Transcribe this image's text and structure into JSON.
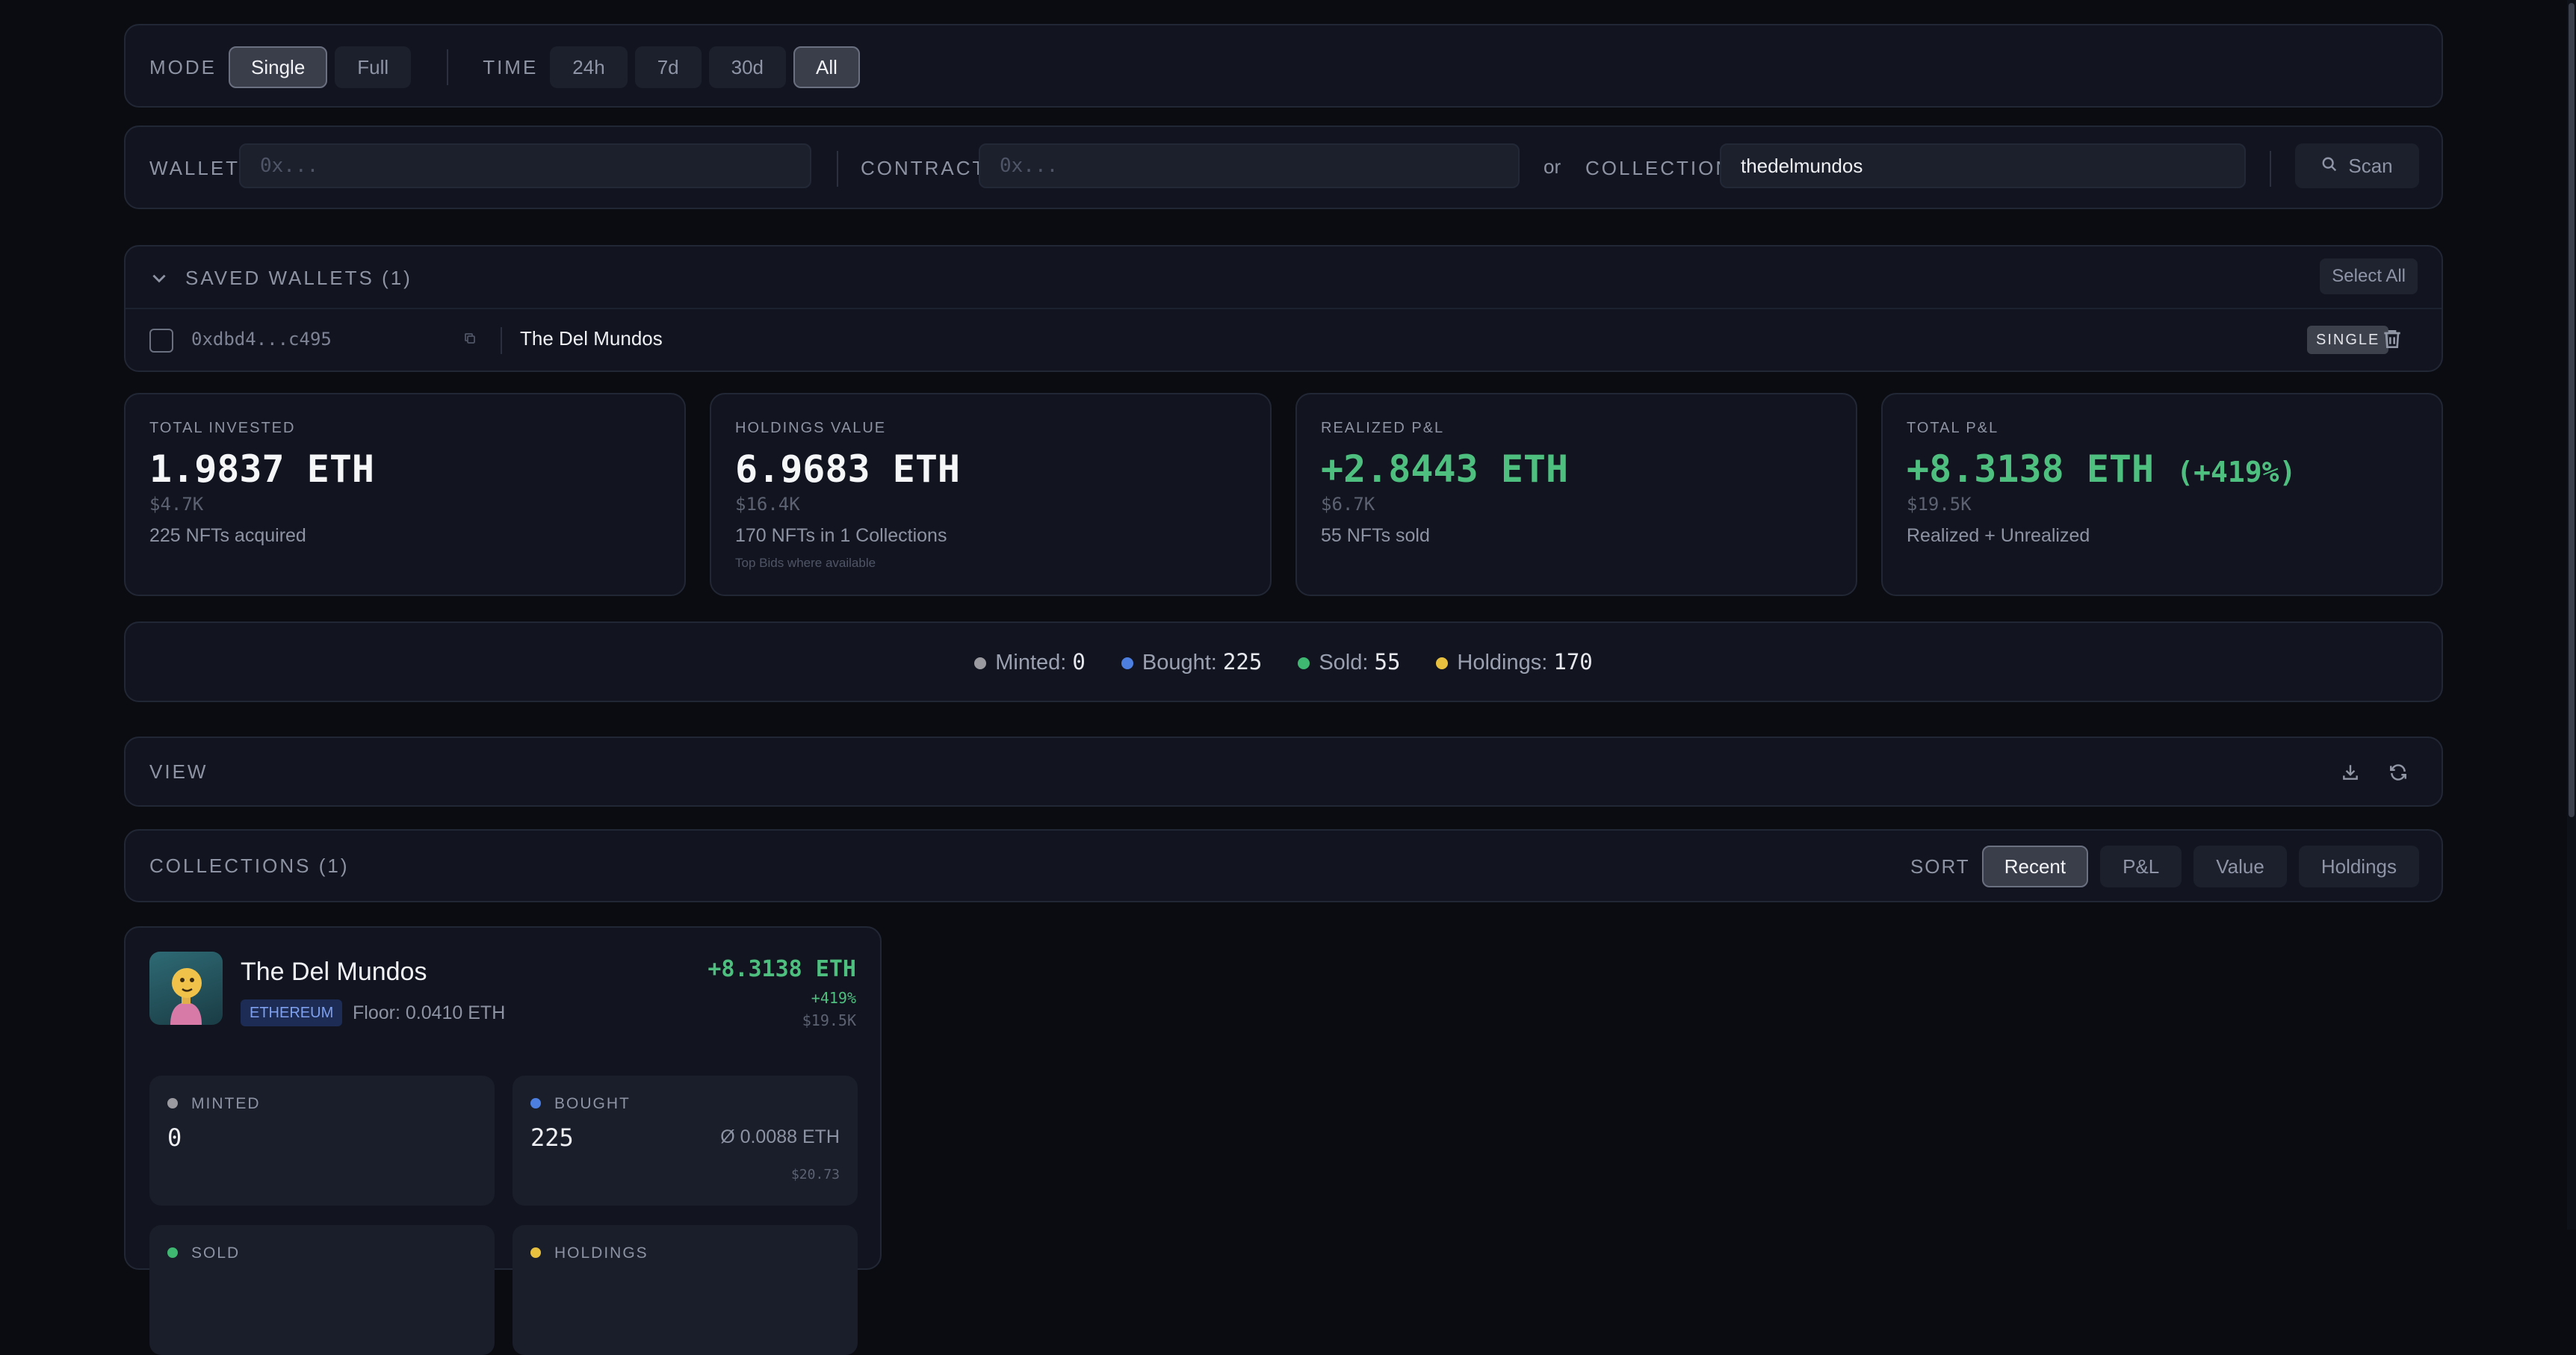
{
  "colors": {
    "background": "#0b0c12",
    "panel": "#121520",
    "accent_green": "#4fbf7f",
    "minted_dot": "#9a9aa0",
    "bought_dot": "#4c7fe0",
    "sold_dot": "#3fb872",
    "holdings_dot": "#e8c040",
    "chain_badge_bg": "#1d2c55",
    "chain_badge_text": "#7ea0ee"
  },
  "filters": {
    "mode_label": "MODE",
    "mode_options": [
      "Single",
      "Full"
    ],
    "mode_selected": "Single",
    "time_label": "TIME",
    "time_options": [
      "24h",
      "7d",
      "30d",
      "All"
    ],
    "time_selected": "All"
  },
  "search": {
    "wallet_label": "WALLET",
    "wallet_placeholder": "0x...",
    "contract_label": "CONTRACT",
    "contract_placeholder": "0x...",
    "or_text": "or",
    "collection_label": "COLLECTION",
    "collection_value": "thedelmundos",
    "scan_label": "Scan",
    "scan_icon": "search-icon"
  },
  "saved_wallets": {
    "title": "SAVED WALLETS (1)",
    "select_all": "Select All",
    "items": [
      {
        "address": "0xdbd4...c495",
        "name": "The Del Mundos",
        "mode_badge": "SINGLE"
      }
    ]
  },
  "stats": [
    {
      "label": "TOTAL INVESTED",
      "main": "1.9837 ETH",
      "pct": "",
      "usd": "$4.7K",
      "sub": "225 NFTs acquired",
      "tiny": ""
    },
    {
      "label": "HOLDINGS VALUE",
      "main": "6.9683 ETH",
      "pct": "",
      "usd": "$16.4K",
      "sub": "170 NFTs in 1 Collections",
      "tiny": "Top Bids where available"
    },
    {
      "label": "REALIZED P&L",
      "main": "+2.8443 ETH",
      "pct": "",
      "usd": "$6.7K",
      "sub": "55 NFTs sold",
      "tiny": ""
    },
    {
      "label": "TOTAL P&L",
      "main": "+8.3138 ETH",
      "pct": "(+419%)",
      "usd": "$19.5K",
      "sub": "Realized + Unrealized",
      "tiny": ""
    }
  ],
  "legend": [
    {
      "label": "Minted:",
      "value": "0"
    },
    {
      "label": "Bought:",
      "value": "225"
    },
    {
      "label": "Sold:",
      "value": "55"
    },
    {
      "label": "Holdings:",
      "value": "170"
    }
  ],
  "view": {
    "title": "VIEW"
  },
  "collections": {
    "title": "COLLECTIONS (1)",
    "sort_label": "SORT",
    "sort_options": [
      "Recent",
      "P&L",
      "Value",
      "Holdings"
    ],
    "sort_selected": "Recent"
  },
  "collection_card": {
    "name": "The Del Mundos",
    "chain": "ETHEREUM",
    "floor": "Floor: 0.0410 ETH",
    "pnl": "+8.3138 ETH",
    "pnl_pct": "+419%",
    "pnl_usd": "$19.5K",
    "minted_label": "MINTED",
    "minted_value": "0",
    "bought_label": "BOUGHT",
    "bought_value": "225",
    "bought_avg": "Ø 0.0088 ETH",
    "bought_usd": "$20.73",
    "sold_label": "SOLD",
    "holdings_label": "HOLDINGS"
  }
}
